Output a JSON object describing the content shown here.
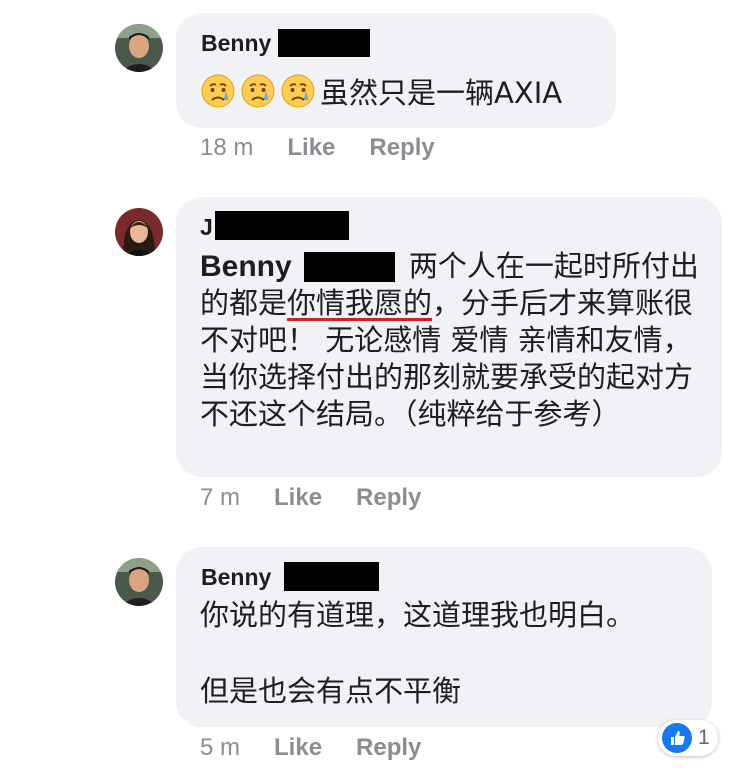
{
  "comments": [
    {
      "author": "Benny",
      "text": "虽然只是一辆AXIA",
      "emoji": [
        "crying-face",
        "crying-face",
        "crying-face"
      ],
      "time": "18 m",
      "like": "Like",
      "reply": "Reply"
    },
    {
      "author": "J",
      "mention": "Benny",
      "text_part1": " 两个人在一起时所付出的都是",
      "underlined": "你情我愿的",
      "text_part2": "，分手后才来算账很不对吧！ 无论感情 爱情 亲情和友情，当你选择付出的那刻就要承受的起对方不还这个结局。（纯粹给于参考）",
      "time": "7 m",
      "like": "Like",
      "reply": "Reply"
    },
    {
      "author": "Benny",
      "text_line1": "你说的有道理，这道理我也明白。",
      "text_line2": "但是也会有点不平衡",
      "time": "5 m",
      "like": "Like",
      "reply": "Reply",
      "reaction_icon": "thumbs-up-icon",
      "reaction_count": "1"
    }
  ],
  "colors": {
    "bubble": "#f0f2f5",
    "meta": "#8a8d91",
    "like_blue": "#1877f2",
    "underline": "#d0202a"
  }
}
